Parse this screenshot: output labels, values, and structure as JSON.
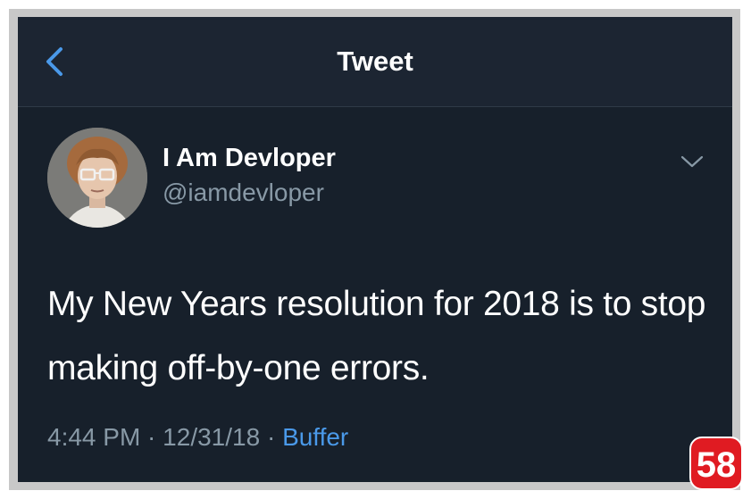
{
  "nav": {
    "title": "Tweet",
    "back_icon": "chevron-left-icon"
  },
  "author": {
    "display_name": "I Am Devloper",
    "handle": "@iamdevloper",
    "avatar": "avatar-photo"
  },
  "tweet": {
    "text": "My New Years resolution for 2018 is to stop making off-by-one errors.",
    "time": "4:44 PM",
    "separator1": " · ",
    "date": "12/31/18",
    "separator2": " · ",
    "source": "Buffer"
  },
  "badge": {
    "label": "58",
    "color": "#e01b22"
  },
  "colors": {
    "background": "#17202b",
    "accent": "#4a99e9",
    "muted": "#8899a6"
  }
}
